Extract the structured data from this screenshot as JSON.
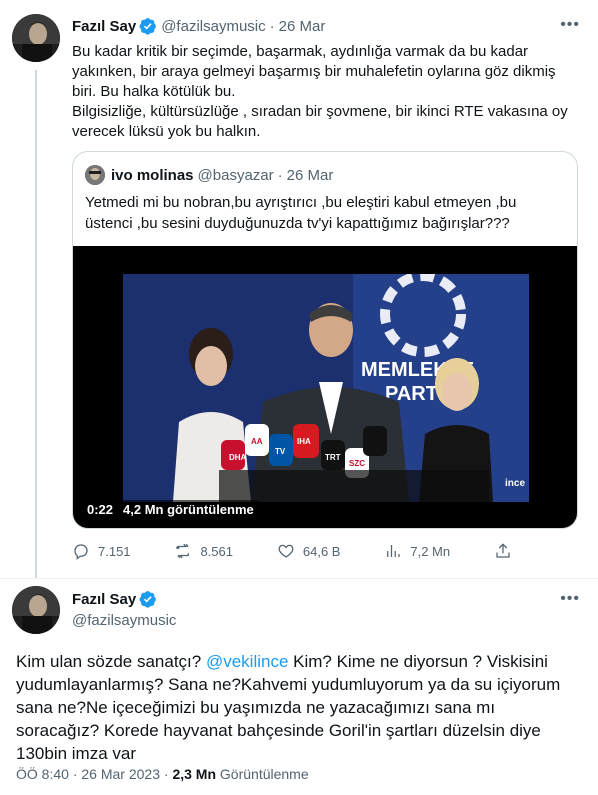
{
  "tweet1": {
    "name": "Fazıl Say",
    "handle": "@fazilsaymusic",
    "date": "26 Mar",
    "text_p1": "Bu kadar kritik bir seçimde, başarmak, aydınlığa varmak da bu kadar yakınken, bir araya gelmeyi başarmış bir muhalefetin oylarına göz dikmiş biri. Bu halka kötülük bu.",
    "text_p2": "Bilgisizliğe, kültürsüzlüğe , sıradan bir şovmene, bir ikinci RTE vakasına oy verecek lüksü yok bu halkın.",
    "quote": {
      "name": "ivo molinas",
      "handle": "@basyazar",
      "date": "26 Mar",
      "text": "Yetmedi mi bu nobran,bu ayrıştırıcı ,bu eleştiri kabul etmeyen ,bu üstenci ,bu sesini duyduğunuzda tv'yi kapattığımız bağırışlar???",
      "video": {
        "duration": "0:22",
        "views": "4,2 Mn görüntülenme",
        "bg_text_1": "MEMLEKET",
        "bg_text_2": "PARTISI",
        "mic_labels": [
          "DHA",
          "AA",
          "TV",
          "IHA",
          "TRT",
          "SZC"
        ],
        "watermark": "ince"
      }
    },
    "actions": {
      "replies": "7.151",
      "retweets": "8.561",
      "likes": "64,6 B",
      "views": "7,2 Mn"
    }
  },
  "tweet2": {
    "name": "Fazıl Say",
    "handle": "@fazilsaymusic",
    "text_before": "Kim ulan sözde sanatçı? ",
    "mention": "@vekilince",
    "text_after": "  Kim? Kime ne diyorsun ? Viskisini yudumlayanlarmış? Sana ne?Kahvemi yudumluyorum ya da su içiyorum sana ne?Ne içeceğimizi bu yaşımızda ne yazacağımızı sana mı soracağız? Korede hayvanat bahçesinde Goril'in şartları düzelsin diye 130bin imza var",
    "time": "ÖÖ 8:40",
    "date": "26 Mar 2023",
    "views_count": "2,3 Mn",
    "views_label": "Görüntülenme"
  },
  "icons": {
    "verified": "verified-badge-icon",
    "more": "more-icon",
    "reply": "reply-icon",
    "retweet": "retweet-icon",
    "like": "like-icon",
    "views": "views-icon",
    "share": "share-icon"
  },
  "colors": {
    "accent": "#1d9bf0",
    "secondary_text": "#536471"
  }
}
